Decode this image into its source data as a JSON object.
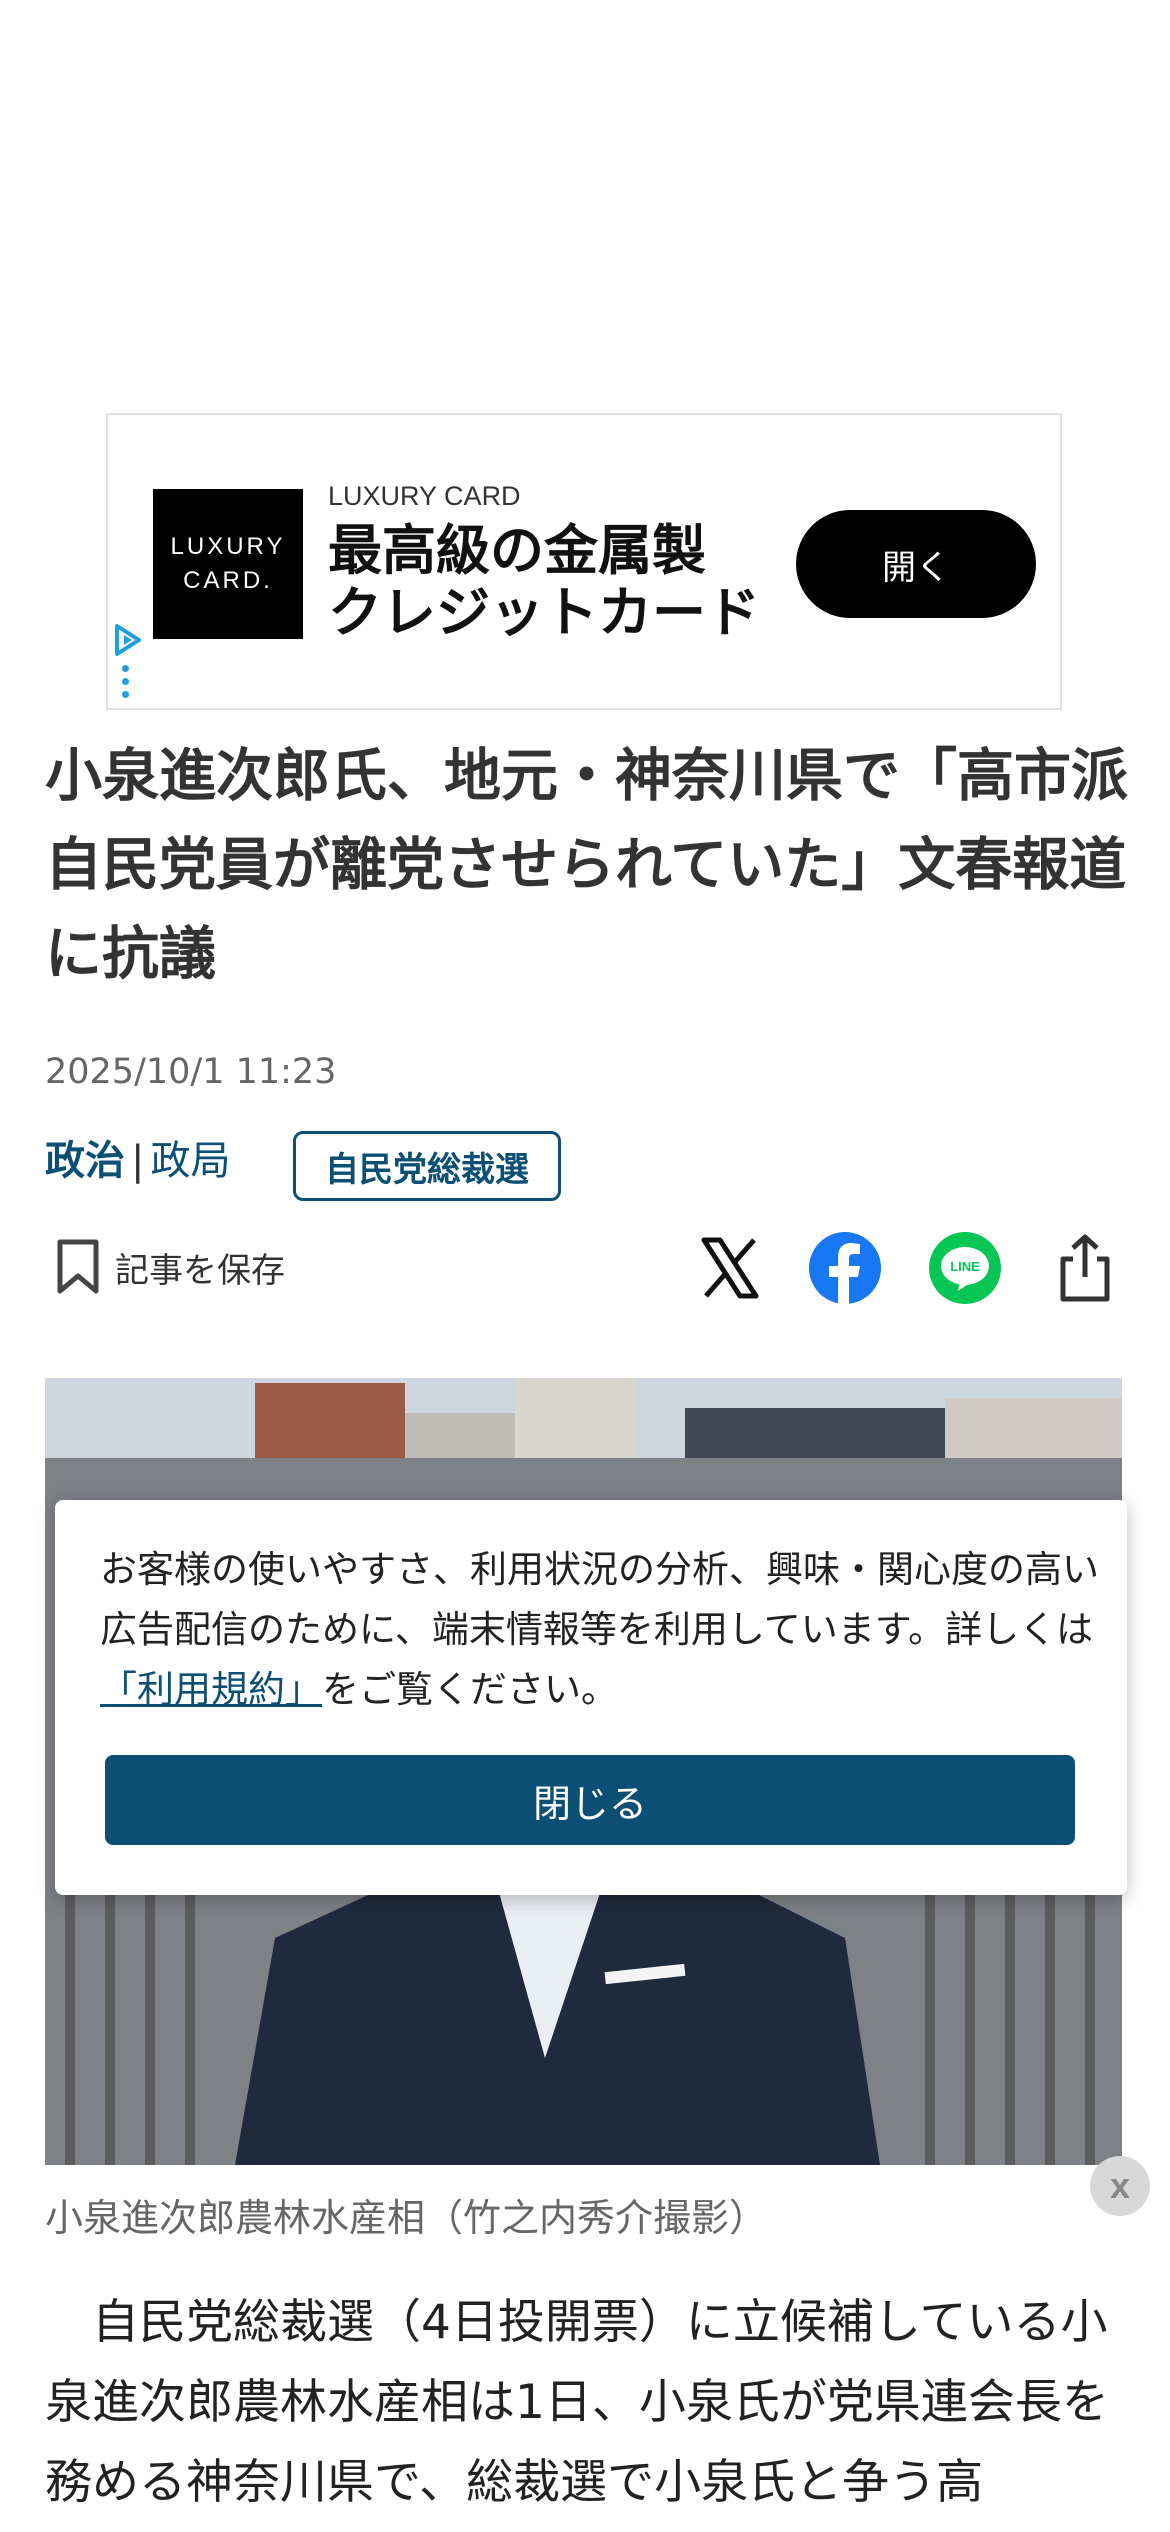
{
  "ad": {
    "logo_line1": "LUXURY",
    "logo_line2": "CARD.",
    "brand": "LUXURY CARD",
    "headline_line1": "最高級の金属製",
    "headline_line2": "クレジットカード",
    "open_button": "開く"
  },
  "article": {
    "title": "小泉進次郎氏、地元・神奈川県で「高市派自民党員が離党させられていた」文春報道に抗議",
    "date": "2025/10/1 11:23",
    "category_main": "政治",
    "category_separator": "|",
    "category_sub": "政局",
    "tag": "自民党総裁選",
    "save_label": "記事を保存",
    "photo_caption": "小泉進次郎農林水産相（竹之内秀介撮影）",
    "body": "　自民党総裁選（4日投開票）に立候補している小泉進次郎農林水産相は1日、小泉氏が党県連会長を務める神奈川県で、総裁選で小泉氏と争う高"
  },
  "share": {
    "icons": [
      "x-icon",
      "facebook-icon",
      "line-icon",
      "share-icon"
    ],
    "line_label": "LINE"
  },
  "consent": {
    "text_before": "お客様の使いやすさ、利用状況の分析、興味・関心度の高い広告配信のために、端末情報等を利用しています。詳しくは",
    "link_text": "「利用規約」",
    "text_after": "をご覧ください。",
    "close_button": "閉じる"
  },
  "overlay_close": "x",
  "colors": {
    "accent": "#0c4f75",
    "facebook": "#1877f2",
    "line": "#06c755"
  }
}
